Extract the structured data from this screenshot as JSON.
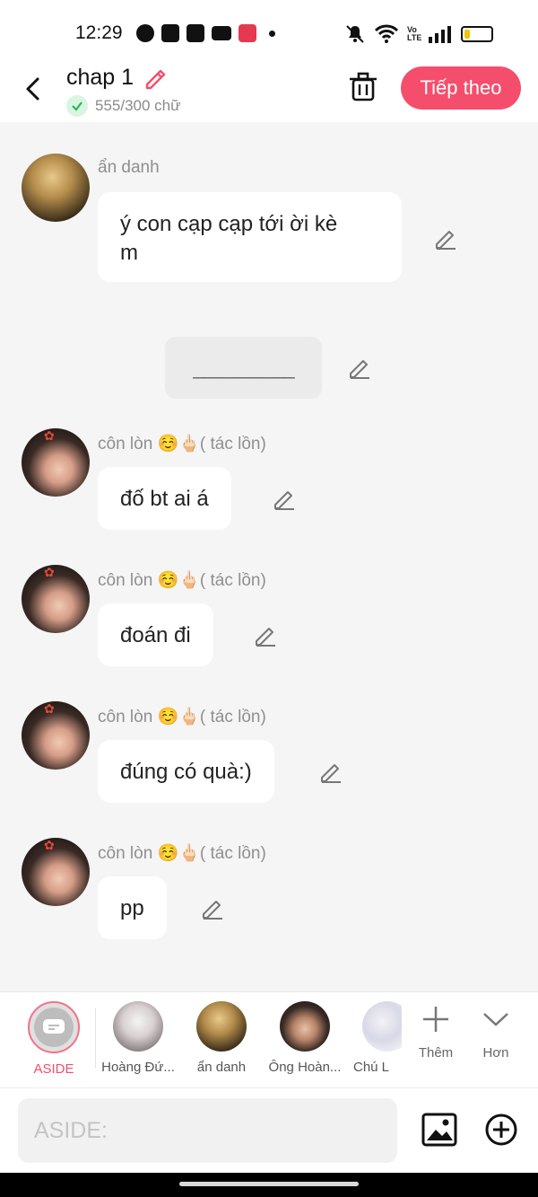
{
  "status": {
    "time": "12:29",
    "volte": "Vo LTE"
  },
  "header": {
    "title": "chap 1",
    "word_count": "555/300 chữ",
    "next_label": "Tiếp theo"
  },
  "messages": [
    {
      "author": "ẩn danh",
      "text": "ý con cạp cạp tới ời kè\nm"
    },
    {
      "aside": "__________"
    },
    {
      "author": "côn lòn ☺️🖕🏻( tác lồn)",
      "text": "đố bt ai á"
    },
    {
      "author": "côn lòn ☺️🖕🏻( tác lồn)",
      "text": "đoán đi"
    },
    {
      "author": "côn lòn ☺️🖕🏻( tác lồn)",
      "text": "đúng có quà:)"
    },
    {
      "author": "côn lòn ☺️🖕🏻( tác lồn)",
      "text": "pp"
    }
  ],
  "characters": [
    {
      "label": "ASIDE"
    },
    {
      "label": "Hoàng Đứ..."
    },
    {
      "label": "ẩn danh"
    },
    {
      "label": "Ông Hoàn..."
    },
    {
      "label": "Chú L"
    }
  ],
  "tools": {
    "more_label": "Thêm",
    "collapse_label": "Hơn"
  },
  "input": {
    "placeholder": "ASIDE:"
  },
  "colors": {
    "accent": "#f54e6c",
    "aside_accent": "#f0506e",
    "background": "#f5f5f5"
  }
}
